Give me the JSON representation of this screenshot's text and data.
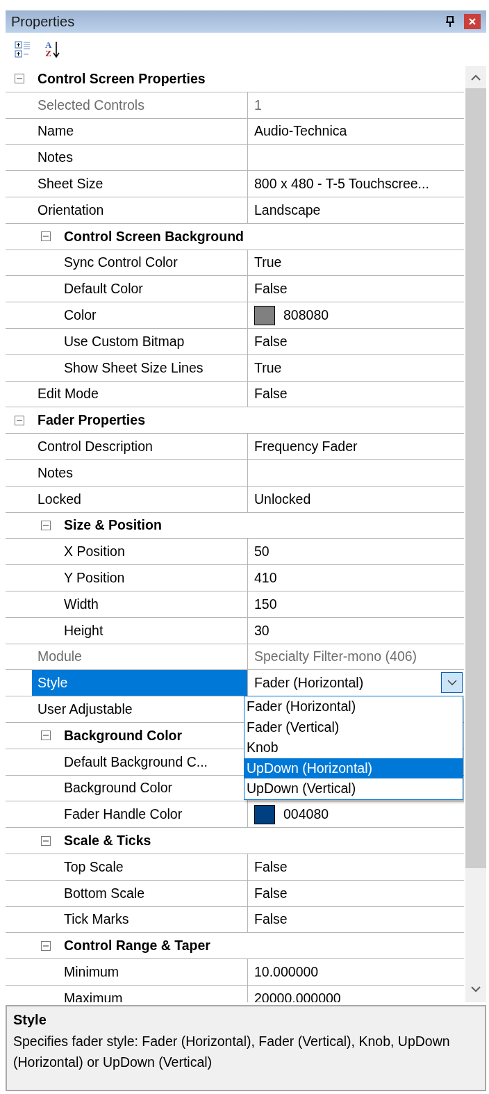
{
  "window": {
    "title": "Properties"
  },
  "toolbar": [
    {
      "kind": "categorized"
    },
    {
      "kind": "alphabetical",
      "letters": [
        "A",
        "Z"
      ]
    }
  ],
  "grid": {
    "items": [
      {
        "kind": "category",
        "label": "Control Screen Properties",
        "expanded": true,
        "children": [
          {
            "kind": "property",
            "label": "Selected Controls",
            "value": "1",
            "disabled": true,
            "selected": false
          },
          {
            "kind": "property",
            "label": "Name",
            "value": "Audio-Technica",
            "disabled": false,
            "selected": false
          },
          {
            "kind": "property",
            "label": "Notes",
            "disabled": false,
            "selected": false
          },
          {
            "kind": "property",
            "label": "Sheet Size",
            "value": "800 x 480 - T-5 Touchscree...",
            "disabled": false,
            "selected": false
          },
          {
            "kind": "property",
            "label": "Orientation",
            "value": "Landscape",
            "disabled": false,
            "selected": false
          },
          {
            "kind": "category",
            "label": "Control Screen Background",
            "expanded": true,
            "children": [
              {
                "kind": "property",
                "label": "Sync Control Color",
                "value": "True",
                "disabled": false,
                "selected": false
              },
              {
                "kind": "property",
                "label": "Default Color",
                "value": "False",
                "disabled": false,
                "selected": false
              },
              {
                "kind": "property",
                "label": "Color",
                "value": "808080",
                "color": "#808080",
                "disabled": false,
                "selected": false
              },
              {
                "kind": "property",
                "label": "Use Custom Bitmap",
                "value": "False",
                "disabled": false,
                "selected": false
              },
              {
                "kind": "property",
                "label": "Show Sheet Size Lines",
                "value": "True",
                "disabled": false,
                "selected": false
              }
            ]
          },
          {
            "kind": "property",
            "label": "Edit Mode",
            "value": "False",
            "disabled": false,
            "selected": false
          }
        ]
      },
      {
        "kind": "category",
        "label": "Fader Properties",
        "expanded": true,
        "children": [
          {
            "kind": "property",
            "label": "Control Description",
            "value": "Frequency Fader",
            "disabled": false,
            "selected": false
          },
          {
            "kind": "property",
            "label": "Notes",
            "disabled": false,
            "selected": false
          },
          {
            "kind": "property",
            "label": "Locked",
            "value": "Unlocked",
            "disabled": false,
            "selected": false
          },
          {
            "kind": "category",
            "label": "Size & Position",
            "expanded": true,
            "children": [
              {
                "kind": "property",
                "label": "X Position",
                "value": "50",
                "disabled": false,
                "selected": false
              },
              {
                "kind": "property",
                "label": "Y Position",
                "value": "410",
                "disabled": false,
                "selected": false
              },
              {
                "kind": "property",
                "label": "Width",
                "value": "150",
                "disabled": false,
                "selected": false
              },
              {
                "kind": "property",
                "label": "Height",
                "value": "30",
                "disabled": false,
                "selected": false
              }
            ]
          },
          {
            "kind": "property",
            "label": "Module",
            "value": "Specialty Filter-mono (406)",
            "disabled": true,
            "selected": false
          },
          {
            "kind": "property",
            "label": "Style",
            "value": "Fader (Horizontal)",
            "disabled": false,
            "selected": true,
            "dropdown": {
              "open": true,
              "options": [
                {
                  "label": "Fader (Horizontal)",
                  "selected": false
                },
                {
                  "label": "Fader (Vertical)",
                  "selected": false
                },
                {
                  "label": "Knob",
                  "selected": false
                },
                {
                  "label": "UpDown (Horizontal)",
                  "selected": true
                },
                {
                  "label": "UpDown (Vertical)",
                  "selected": false
                }
              ]
            }
          },
          {
            "kind": "property",
            "label": "User Adjustable",
            "disabled": false,
            "selected": false
          },
          {
            "kind": "category",
            "label": "Background Color",
            "expanded": true,
            "children": [
              {
                "kind": "property",
                "label": "Default Background C...",
                "disabled": false,
                "selected": false
              },
              {
                "kind": "property",
                "label": "Background Color",
                "disabled": false,
                "selected": false
              },
              {
                "kind": "property",
                "label": "Fader Handle Color",
                "value": "004080",
                "color": "#004080",
                "disabled": false,
                "selected": false
              }
            ]
          },
          {
            "kind": "category",
            "label": "Scale & Ticks",
            "expanded": true,
            "children": [
              {
                "kind": "property",
                "label": "Top Scale",
                "value": "False",
                "disabled": false,
                "selected": false
              },
              {
                "kind": "property",
                "label": "Bottom Scale",
                "value": "False",
                "disabled": false,
                "selected": false
              },
              {
                "kind": "property",
                "label": "Tick Marks",
                "value": "False",
                "disabled": false,
                "selected": false
              }
            ]
          },
          {
            "kind": "category",
            "label": "Control Range & Taper",
            "expanded": true,
            "children": [
              {
                "kind": "property",
                "label": "Minimum",
                "value": "10.000000",
                "disabled": false,
                "selected": false
              },
              {
                "kind": "property",
                "label": "Maximum",
                "value": "20000.000000",
                "disabled": false,
                "selected": false
              }
            ]
          }
        ]
      }
    ]
  },
  "description": {
    "title": "Style",
    "text": "Specifies fader style: Fader (Horizontal), Fader (Vertical), Knob, UpDown (Horizontal) or UpDown (Vertical)"
  }
}
